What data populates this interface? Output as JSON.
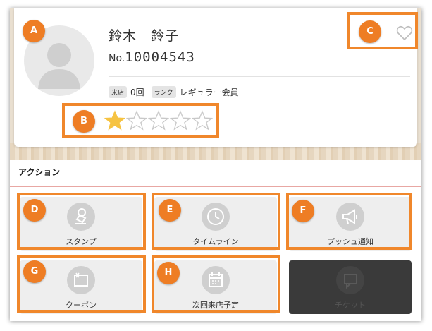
{
  "member": {
    "name": "鈴木　鈴子",
    "no_prefix": "No.",
    "number": "10004543",
    "visits_tag": "来店",
    "visits_value": "0回",
    "rank_tag": "ランク",
    "rank_value": "レギュラー会員",
    "rating": 1,
    "rating_max": 5
  },
  "actions": {
    "title": "アクション",
    "items": [
      {
        "label": "スタンプ",
        "icon": "stamp-icon",
        "enabled": true
      },
      {
        "label": "タイムライン",
        "icon": "clock-icon",
        "enabled": true
      },
      {
        "label": "プッシュ通知",
        "icon": "megaphone-icon",
        "enabled": true
      },
      {
        "label": "クーポン",
        "icon": "coupon-icon",
        "enabled": true
      },
      {
        "label": "次回来店予定",
        "icon": "calendar-icon",
        "enabled": true
      },
      {
        "label": "チケット",
        "icon": "ticket-icon",
        "enabled": false
      }
    ]
  },
  "annotations": [
    "A",
    "B",
    "C",
    "D",
    "E",
    "F",
    "G",
    "H"
  ],
  "colors": {
    "highlight": "#f0872b",
    "badge": "#ee7d24",
    "star_filled": "#f6c342",
    "title_underline": "#e8a7a3"
  }
}
